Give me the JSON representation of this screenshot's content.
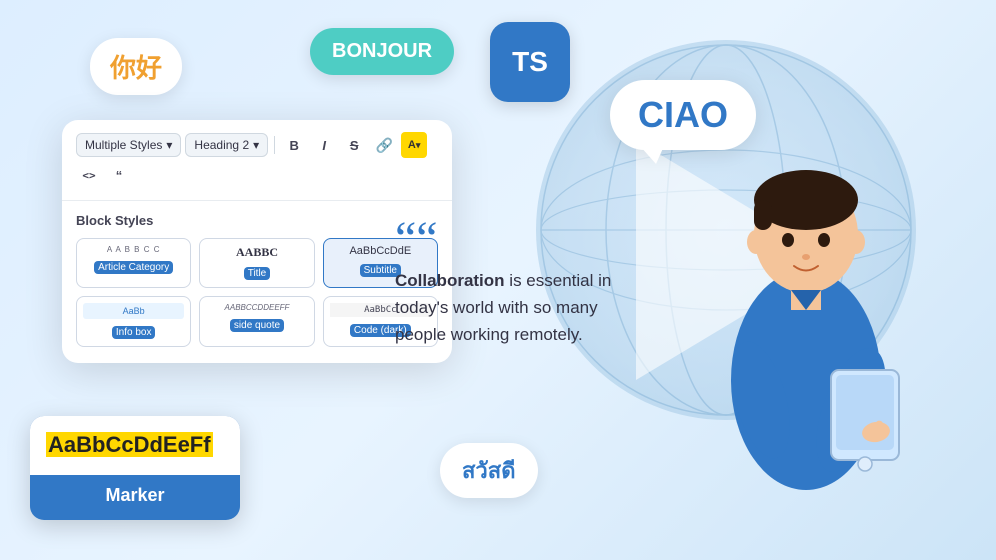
{
  "background": {
    "color": "#ddeeff"
  },
  "bubbles": {
    "nihao": {
      "text": "你好"
    },
    "bonjour": {
      "text": "BONJOUR"
    },
    "ts": {
      "text": "TS"
    },
    "ciao": {
      "text": "CIAO"
    },
    "sawadee": {
      "text": "สวัสดี"
    }
  },
  "toolbar": {
    "style_select": "Multiple Styles",
    "heading_select": "Heading 2",
    "bold": "B",
    "italic": "I",
    "strikethrough": "S",
    "link": "🔗",
    "highlight": "A",
    "code_inline": "<>",
    "blockquote": "““"
  },
  "block_styles": {
    "title": "Block Styles",
    "items": [
      {
        "preview": "A A B B C C",
        "label": "Article Category",
        "type": "article"
      },
      {
        "preview": "AABBC",
        "label": "Title",
        "type": "title"
      },
      {
        "preview": "AaBbCcDdE",
        "label": "Subtitle",
        "type": "subtitle",
        "active": true
      },
      {
        "preview": "AaBb",
        "label": "Info box",
        "type": "infobox"
      },
      {
        "preview": "AABBCCDDEEFF",
        "label": "side quote",
        "type": "sidequote"
      },
      {
        "preview": "AaBbCc",
        "label": "Code (dark)",
        "type": "code"
      }
    ]
  },
  "marker_card": {
    "preview_text": "AaBbCcDdEeFf",
    "label": "Marker"
  },
  "quote": {
    "quote_mark": "““",
    "text_bold": "Collaboration",
    "text_rest": " is essential in today’s world with so many people working remotely."
  }
}
